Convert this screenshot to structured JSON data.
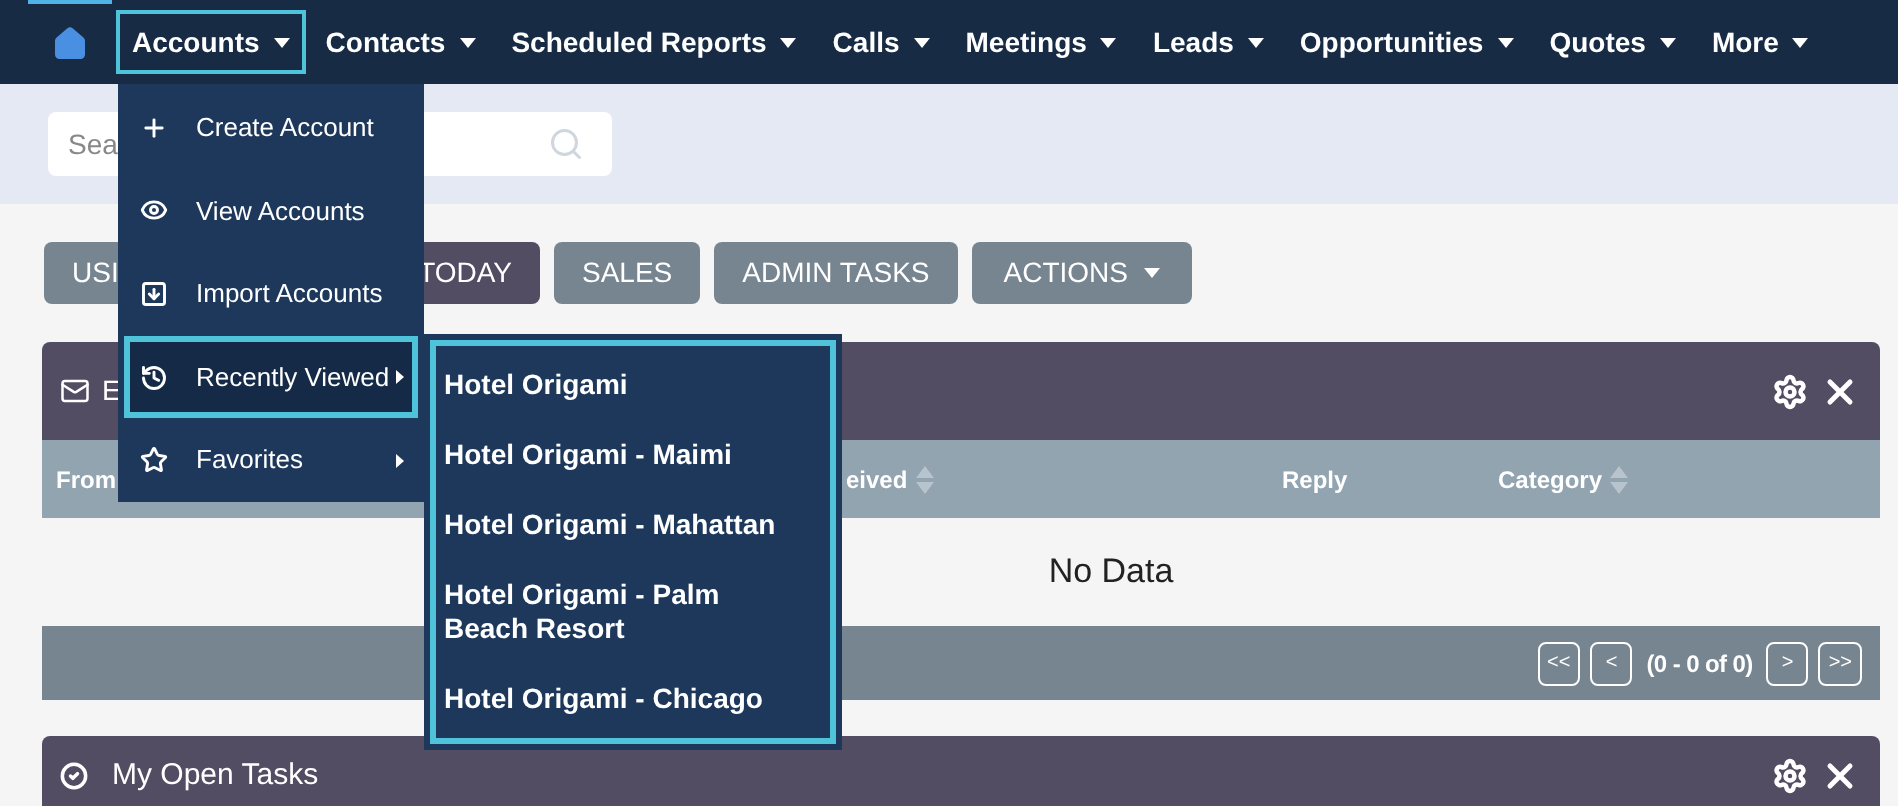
{
  "nav": {
    "items": [
      {
        "label": "Accounts",
        "selected": true
      },
      {
        "label": "Contacts",
        "selected": false
      },
      {
        "label": "Scheduled Reports",
        "selected": false
      },
      {
        "label": "Calls",
        "selected": false
      },
      {
        "label": "Meetings",
        "selected": false
      },
      {
        "label": "Leads",
        "selected": false
      },
      {
        "label": "Opportunities",
        "selected": false
      },
      {
        "label": "Quotes",
        "selected": false
      },
      {
        "label": "More",
        "selected": false
      }
    ]
  },
  "accounts_menu": {
    "items": [
      {
        "label": "Create Account",
        "selected": false,
        "submenu": false
      },
      {
        "label": "View Accounts",
        "selected": false,
        "submenu": false
      },
      {
        "label": "Import Accounts",
        "selected": false,
        "submenu": false
      },
      {
        "label": "Recently Viewed",
        "selected": true,
        "submenu": true
      },
      {
        "label": "Favorites",
        "selected": false,
        "submenu": true
      }
    ]
  },
  "recently_viewed": [
    "Hotel Origami",
    "Hotel Origami - Maimi",
    "Hotel Origami - Mahattan",
    "Hotel Origami - Palm Beach Resort",
    "Hotel Origami - Chicago"
  ],
  "search": {
    "placeholder": "Sea"
  },
  "tabs": [
    {
      "label": "USI",
      "selected": false
    },
    {
      "label": "TODAY",
      "selected": true
    },
    {
      "label": "SALES",
      "selected": false
    },
    {
      "label": "ADMIN TASKS",
      "selected": false
    }
  ],
  "actions": {
    "label": "ACTIONS"
  },
  "dashlet": {
    "title": "E",
    "columns": [
      {
        "label": "From"
      },
      {
        "label": "eived",
        "sortable": true
      },
      {
        "label": "Reply",
        "sortable": false
      },
      {
        "label": "Category",
        "sortable": true
      }
    ],
    "empty": "No Data",
    "pagination": {
      "first": "<<",
      "prev": "<",
      "range": "(0 - 0 of 0)",
      "next": ">",
      "last": ">>"
    }
  },
  "dashlet_2": {
    "title": "My Open Tasks"
  }
}
